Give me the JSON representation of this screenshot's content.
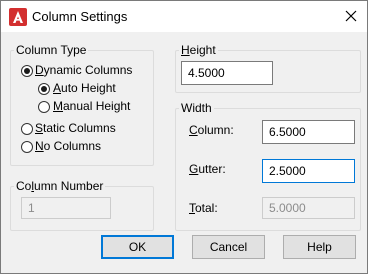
{
  "window": {
    "title": "Column Settings",
    "app_icon": "autocad-logo-icon",
    "close_icon": "close-icon"
  },
  "column_type": {
    "legend": "Column Type",
    "options": [
      {
        "label": "Dynamic Columns",
        "selected": true
      },
      {
        "label": "Static Columns",
        "selected": false
      },
      {
        "label": "No Columns",
        "selected": false
      }
    ],
    "sub_options": [
      {
        "label": "Auto Height",
        "selected": true
      },
      {
        "label": "Manual Height",
        "selected": false
      }
    ]
  },
  "column_number": {
    "legend": "Column Number",
    "value": "1"
  },
  "height": {
    "legend": "Height",
    "value": "4.5000"
  },
  "width": {
    "legend": "Width",
    "column_label": "Column:",
    "column_value": "6.5000",
    "gutter_label": "Gutter:",
    "gutter_value": "2.5000",
    "total_label": "Total:",
    "total_value": "5.0000"
  },
  "buttons": {
    "ok": "OK",
    "cancel": "Cancel",
    "help": "Help"
  },
  "colors": {
    "accent": "#0078d7",
    "app_icon_red": "#d32f2f"
  }
}
